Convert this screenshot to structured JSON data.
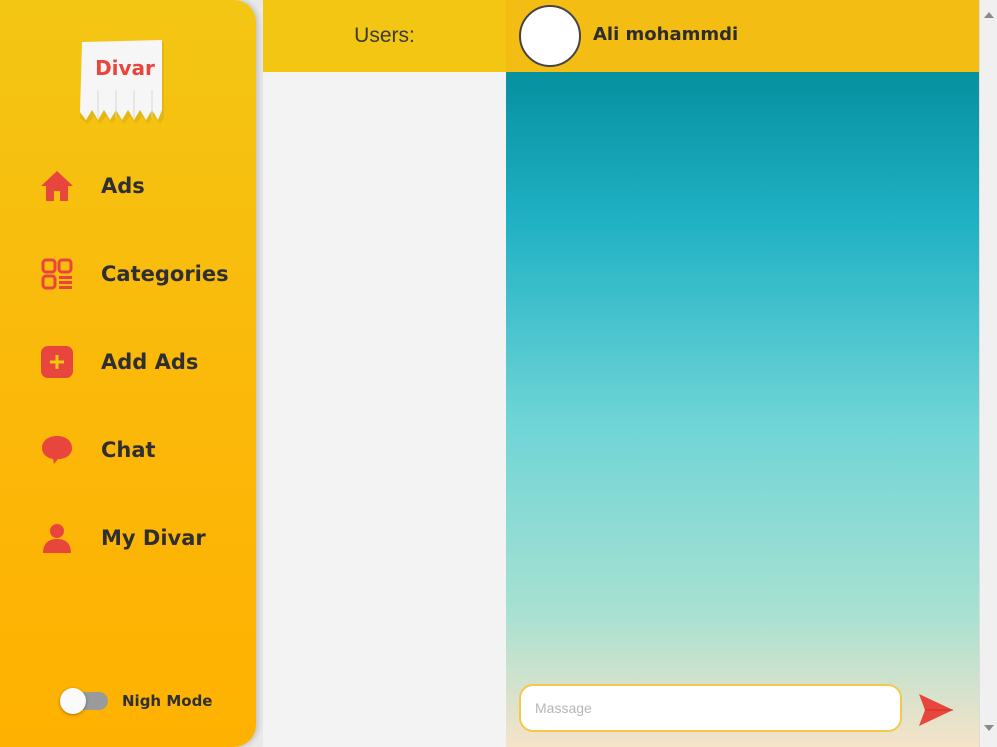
{
  "sidebar": {
    "logo_text": "Divar",
    "items": [
      {
        "label": "Ads",
        "icon": "home-icon"
      },
      {
        "label": "Categories",
        "icon": "grid-list-icon"
      },
      {
        "label": "Add Ads",
        "icon": "plus-square-icon"
      },
      {
        "label": "Chat",
        "icon": "chat-bubble-icon"
      },
      {
        "label": "My Divar",
        "icon": "user-icon"
      }
    ],
    "night_mode": {
      "label": "Nigh Mode",
      "enabled": false
    }
  },
  "users_panel": {
    "title": "Users:"
  },
  "chat": {
    "contact_name": "Ali mohammdi",
    "input_placeholder": "Massage",
    "send_icon": "send-icon"
  },
  "colors": {
    "accent": "#e8453c",
    "sidebar_yellow": "#f3c614",
    "header_yellow": "#f3bd14"
  }
}
